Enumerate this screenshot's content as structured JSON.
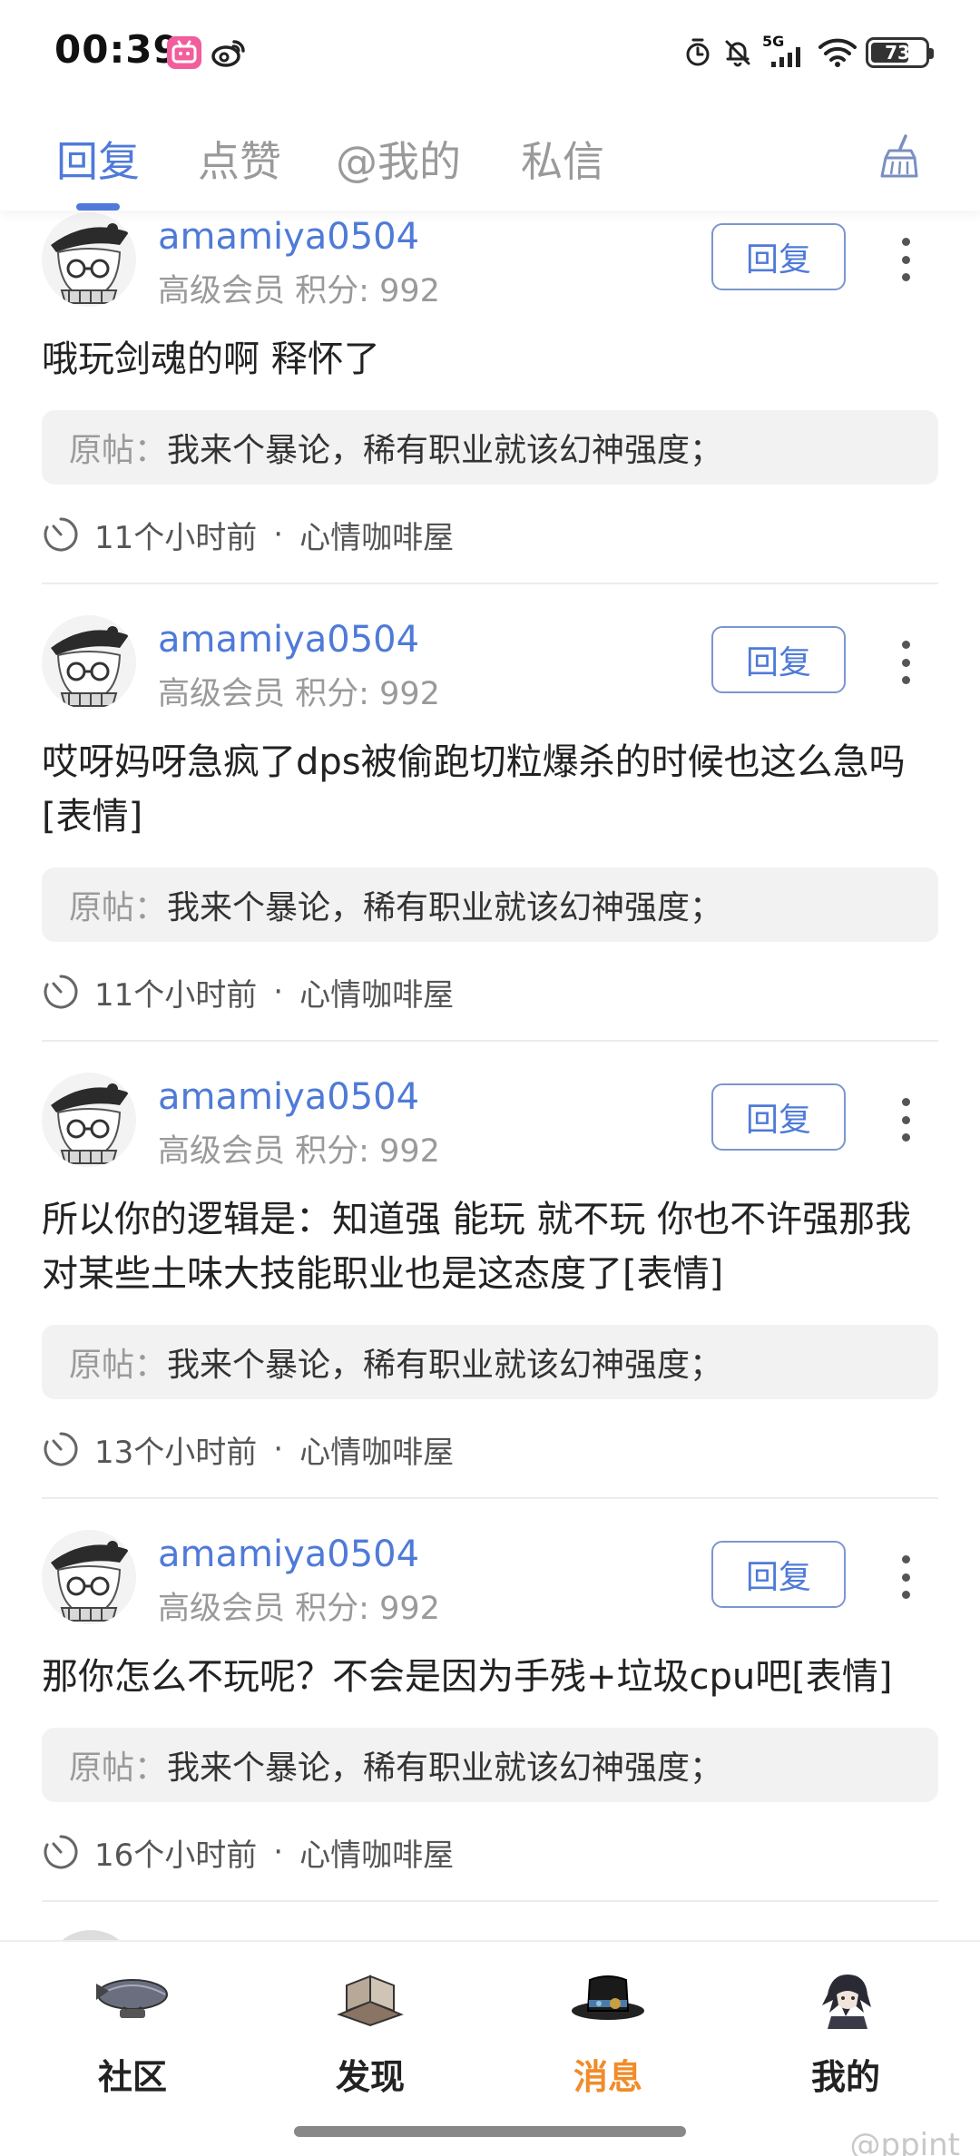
{
  "status_bar": {
    "time": "00:39",
    "network": "5G",
    "battery": "73",
    "battery_level": 0.73
  },
  "tabs": {
    "items": [
      {
        "label": "回复",
        "active": true
      },
      {
        "label": "点赞",
        "active": false
      },
      {
        "label": "@我的",
        "active": false
      },
      {
        "label": "私信",
        "active": false
      }
    ]
  },
  "feed": {
    "posts": [
      {
        "username": "amamiya0504",
        "level": "高级会员",
        "points": "积分: 992",
        "reply_label": "回复",
        "text": "哦玩剑魂的啊 释怀了",
        "quote_label": "原帖：",
        "quote_text": "我来个暴论，稀有职业就该幻神强度；",
        "time": "11个小时前",
        "separator": "·",
        "forum": "心情咖啡屋"
      },
      {
        "username": "amamiya0504",
        "level": "高级会员",
        "points": "积分: 992",
        "reply_label": "回复",
        "text": "哎呀妈呀急疯了dps被偷跑切粒爆杀的时候也这么急吗[表情]",
        "quote_label": "原帖：",
        "quote_text": "我来个暴论，稀有职业就该幻神强度；",
        "time": "11个小时前",
        "separator": "·",
        "forum": "心情咖啡屋"
      },
      {
        "username": "amamiya0504",
        "level": "高级会员",
        "points": "积分: 992",
        "reply_label": "回复",
        "text": "所以你的逻辑是：知道强 能玩 就不玩 你也不许强那我对某些土味大技能职业也是这态度了[表情]",
        "quote_label": "原帖：",
        "quote_text": "我来个暴论，稀有职业就该幻神强度；",
        "time": "13个小时前",
        "separator": "·",
        "forum": "心情咖啡屋"
      },
      {
        "username": "amamiya0504",
        "level": "高级会员",
        "points": "积分: 992",
        "reply_label": "回复",
        "text": "那你怎么不玩呢？不会是因为手残+垃圾cpu吧[表情]",
        "quote_label": "原帖：",
        "quote_text": "我来个暴论，稀有职业就该幻神强度；",
        "time": "16个小时前",
        "separator": "·",
        "forum": "心情咖啡屋"
      }
    ]
  },
  "bottom_nav": {
    "items": [
      {
        "label": "社区",
        "icon": "community-airship-icon",
        "active": false
      },
      {
        "label": "发现",
        "icon": "discover-book-icon",
        "active": false
      },
      {
        "label": "消息",
        "icon": "messages-hat-icon",
        "active": true
      },
      {
        "label": "我的",
        "icon": "profile-character-icon",
        "active": false
      }
    ]
  },
  "watermark": "@ppint",
  "colors": {
    "accent_blue": "#4f7ad8",
    "active_orange": "#f08c2a",
    "muted_gray": "#9a9a9a",
    "quote_bg": "#f2f2f2"
  }
}
